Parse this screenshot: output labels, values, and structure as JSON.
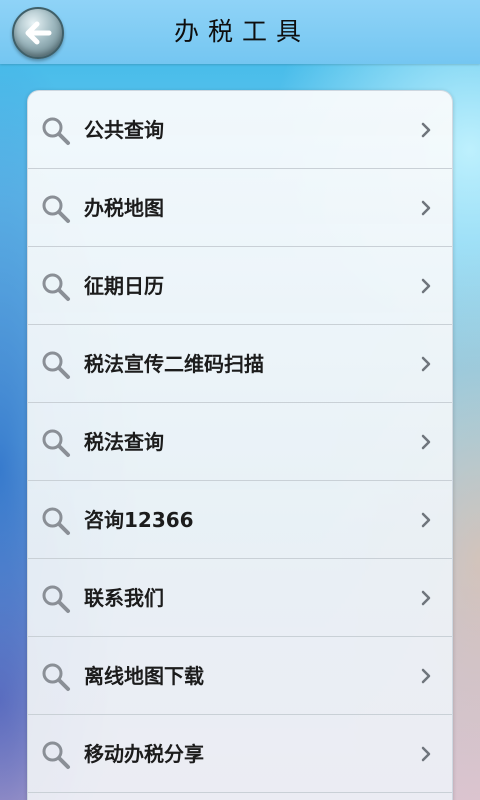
{
  "header": {
    "title": "办税工具",
    "back_icon": "back-arrow-icon"
  },
  "menu": {
    "items": [
      {
        "label": "公共查询"
      },
      {
        "label": "办税地图"
      },
      {
        "label": "征期日历"
      },
      {
        "label": "税法宣传二维码扫描"
      },
      {
        "label": "税法查询"
      },
      {
        "label": "咨询12366"
      },
      {
        "label": "联系我们"
      },
      {
        "label": "离线地图下载"
      },
      {
        "label": "移动办税分享"
      }
    ],
    "item_icon": "search-icon",
    "chevron_icon": "chevron-right-icon"
  },
  "colors": {
    "header_bg": "#8fd3f7",
    "text": "#1c1c1c",
    "icon": "#8a8f96"
  }
}
